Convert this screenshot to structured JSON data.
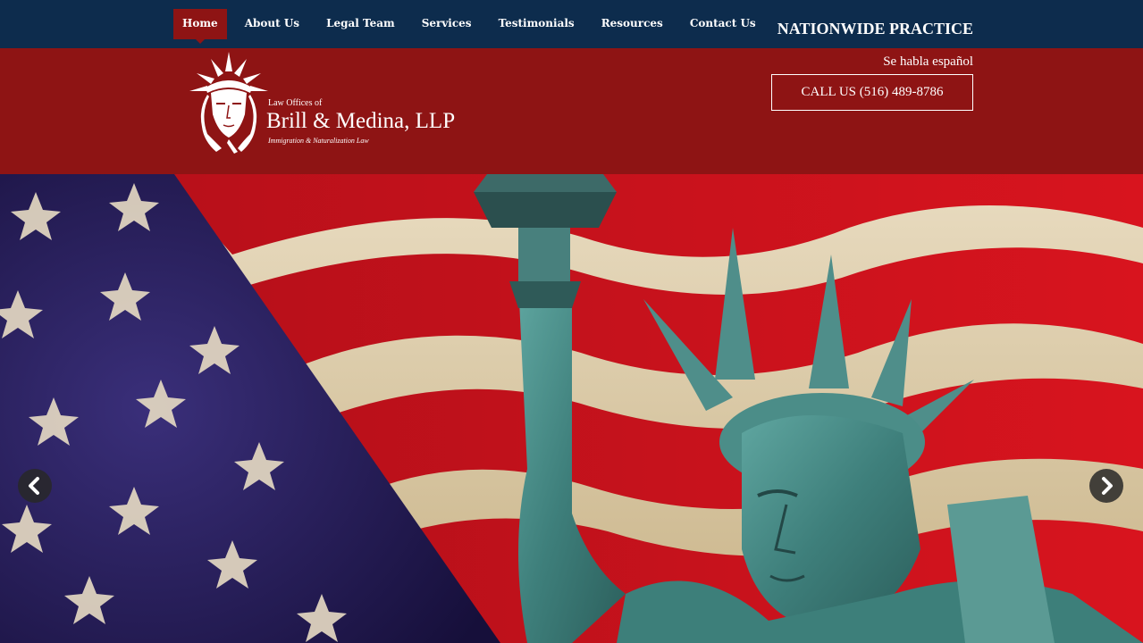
{
  "nav": {
    "items": [
      {
        "label": "Home",
        "active": true
      },
      {
        "label": "About Us"
      },
      {
        "label": "Legal Team"
      },
      {
        "label": "Services"
      },
      {
        "label": "Testimonials"
      },
      {
        "label": "Resources"
      },
      {
        "label": "Contact Us"
      }
    ]
  },
  "header": {
    "tagline": "NATIONWIDE PRACTICE",
    "spanish": "Se habla español",
    "call_label": "CALL US (516) 489-8786",
    "logo": {
      "line1": "Law Offices of",
      "line2": "Brill & Medina, LLP",
      "line3": "Immigration & Naturalization Law"
    }
  },
  "hero": {
    "prev_icon": "chevron-left-icon",
    "next_icon": "chevron-right-icon"
  },
  "colors": {
    "navy": "#0d2c4d",
    "brand_red": "#8e1414",
    "white": "#ffffff"
  }
}
